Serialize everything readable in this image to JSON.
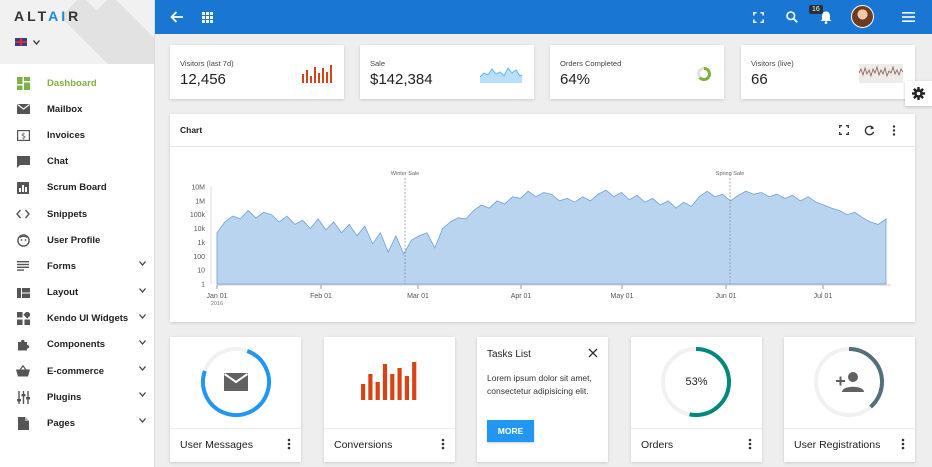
{
  "app": {
    "logo_pre": "ALT",
    "logo_accent": "AI",
    "logo_post": "R",
    "language_icon": "uk-flag-icon"
  },
  "sidebar": {
    "items": [
      {
        "label": "Dashboard",
        "icon": "dashboard-icon",
        "active": true
      },
      {
        "label": "Mailbox",
        "icon": "mail-icon"
      },
      {
        "label": "Invoices",
        "icon": "invoice-icon"
      },
      {
        "label": "Chat",
        "icon": "chat-icon"
      },
      {
        "label": "Scrum Board",
        "icon": "board-icon"
      },
      {
        "label": "Snippets",
        "icon": "code-icon"
      },
      {
        "label": "User Profile",
        "icon": "face-icon"
      },
      {
        "label": "Forms",
        "icon": "form-icon",
        "expandable": true
      },
      {
        "label": "Layout",
        "icon": "layout-icon",
        "expandable": true
      },
      {
        "label": "Kendo UI Widgets",
        "icon": "widgets-icon",
        "expandable": true
      },
      {
        "label": "Components",
        "icon": "puzzle-icon",
        "expandable": true
      },
      {
        "label": "E-commerce",
        "icon": "basket-icon",
        "expandable": true
      },
      {
        "label": "Plugins",
        "icon": "sliders-icon",
        "expandable": true
      },
      {
        "label": "Pages",
        "icon": "page-icon",
        "expandable": true
      }
    ]
  },
  "topbar": {
    "notifications_count": "16",
    "color": "#1976d2"
  },
  "stats": [
    {
      "label": "Visitors (last 7d)",
      "value": "12,456",
      "spark": "bars",
      "color": "#d84315"
    },
    {
      "label": "Sale",
      "value": "$142,384",
      "spark": "area",
      "color": "#64b5f6"
    },
    {
      "label": "Orders Completed",
      "value": "64%",
      "spark": "donut",
      "color": "#7cb342"
    },
    {
      "label": "Visitors (live)",
      "value": "66",
      "spark": "line",
      "color": "#8d6e63"
    }
  ],
  "chart": {
    "title": "Chart"
  },
  "chart_data": {
    "type": "area",
    "yscale": "log",
    "y_ticks": [
      "10M",
      "1M",
      "100k",
      "10k",
      "1k",
      "100",
      "10",
      "1"
    ],
    "x_ticks": [
      "Jan 01",
      "Feb 01",
      "Mar 01",
      "Apr 01",
      "May 01",
      "Jun 01",
      "Jul 01"
    ],
    "x_sub": "2016",
    "annotations": [
      "Winter Sale",
      "Spring Sale"
    ],
    "color": "#b9d4ef",
    "series": [
      {
        "values": [
          5000,
          30000,
          80000,
          50000,
          200000,
          60000,
          150000,
          100000,
          30000,
          80000,
          20000,
          40000,
          10000,
          50000,
          8000,
          30000,
          5000,
          20000,
          3000,
          15000,
          800,
          5000,
          200,
          3000,
          150,
          1500,
          3000,
          5000,
          400,
          10000,
          30000,
          60000,
          50000,
          200000,
          500000,
          300000,
          1000000,
          600000,
          2000000,
          1500000,
          5000000,
          2000000,
          4000000,
          3000000,
          1000000,
          1500000,
          800000,
          2000000,
          1000000,
          3000000,
          6000000,
          2000000,
          4000000,
          1200000,
          2500000,
          800000,
          1500000,
          500000,
          1000000,
          300000,
          800000,
          400000,
          2000000,
          5000000,
          2000000,
          3000000,
          1000000,
          2500000,
          5000000,
          3000000,
          4000000,
          2000000,
          3000000,
          1500000,
          2500000,
          1000000,
          2000000,
          800000,
          500000,
          300000,
          200000,
          100000,
          150000,
          60000,
          30000,
          20000,
          50000
        ]
      }
    ]
  },
  "bottom_cards": {
    "messages": {
      "label": "User Messages",
      "icon": "mail-icon"
    },
    "conversions": {
      "label": "Conversions",
      "values": [
        8,
        13,
        9,
        18,
        13,
        16,
        12,
        19
      ]
    },
    "tasks": {
      "title": "Tasks List",
      "text": "Lorem ipsum dolor sit amet, consectetur adipisicing elit.",
      "button": "MORE"
    },
    "orders": {
      "label": "Orders",
      "percent": "53%",
      "color": "#00897b"
    },
    "registrations": {
      "label": "User Registrations",
      "icon": "add-user-icon",
      "color": "#546e7a"
    }
  }
}
